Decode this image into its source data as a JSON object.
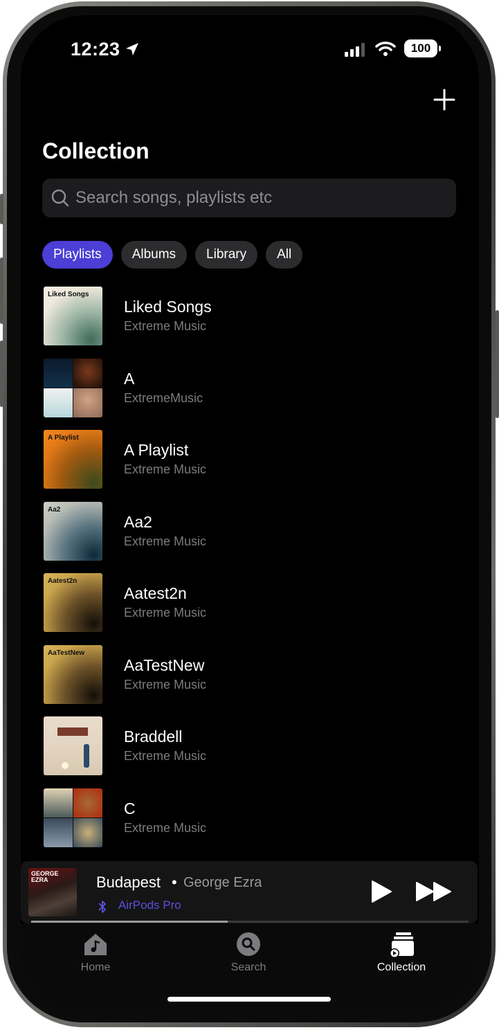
{
  "status": {
    "time": "12:23",
    "battery": "100"
  },
  "header": {
    "title": "Collection"
  },
  "search": {
    "placeholder": "Search songs, playlists etc"
  },
  "filters": [
    {
      "label": "Playlists",
      "active": true
    },
    {
      "label": "Albums",
      "active": false
    },
    {
      "label": "Library",
      "active": false
    },
    {
      "label": "All",
      "active": false
    }
  ],
  "playlists": [
    {
      "title": "Liked Songs",
      "subtitle": "Extreme Music",
      "art_label": "Liked Songs"
    },
    {
      "title": "A",
      "subtitle": "ExtremeMusic",
      "art_label": ""
    },
    {
      "title": "A Playlist",
      "subtitle": "Extreme Music",
      "art_label": "A Playlist"
    },
    {
      "title": "Aa2",
      "subtitle": "Extreme Music",
      "art_label": "Aa2"
    },
    {
      "title": "Aatest2n",
      "subtitle": "Extreme Music",
      "art_label": "Aatest2n"
    },
    {
      "title": "AaTestNew",
      "subtitle": "Extreme Music",
      "art_label": "AaTestNew"
    },
    {
      "title": "Braddell",
      "subtitle": "Extreme Music",
      "art_label": ""
    },
    {
      "title": "C",
      "subtitle": "Extreme Music",
      "art_label": ""
    }
  ],
  "now_playing": {
    "song": "Budapest",
    "separator": "•",
    "artist": "George Ezra",
    "device": "AirPods Pro",
    "art_text": "GEORGE EZRA",
    "progress": 0.45
  },
  "tabs": [
    {
      "label": "Home",
      "icon": "home-music-icon",
      "active": false
    },
    {
      "label": "Search",
      "icon": "search-icon",
      "active": false
    },
    {
      "label": "Collection",
      "icon": "collection-icon",
      "active": true
    }
  ],
  "colors": {
    "accent": "#4b3fd6",
    "device": "#5b4fe0",
    "background": "#000000"
  }
}
